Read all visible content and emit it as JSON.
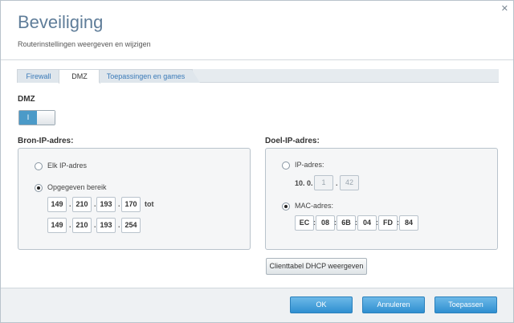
{
  "header": {
    "title": "Beveiliging",
    "subtitle": "Routerinstellingen weergeven en wijzigen",
    "close": "✕"
  },
  "tabs": [
    {
      "label": "Firewall",
      "active": false
    },
    {
      "label": "DMZ",
      "active": true
    },
    {
      "label": "Toepassingen en games",
      "active": false
    }
  ],
  "dmz": {
    "label": "DMZ",
    "toggle_on_label": "I",
    "enabled": true
  },
  "source": {
    "heading": "Bron-IP-adres:",
    "option_any": "Elk IP-adres",
    "option_range": "Opgegeven bereik",
    "selected": "range",
    "to_label": "tot",
    "range_start": [
      "149",
      "210",
      "193",
      "170"
    ],
    "range_end": [
      "149",
      "210",
      "193",
      "254"
    ]
  },
  "destination": {
    "heading": "Doel-IP-adres:",
    "option_ip": "IP-adres:",
    "ip_prefix": "10. 0.",
    "ip_octets": [
      "1",
      "42"
    ],
    "option_mac": "MAC-adres:",
    "selected": "mac",
    "mac_parts": [
      "EC",
      "08",
      "6B",
      "04",
      "FD",
      "84"
    ],
    "dhcp_button": "Clienttabel DHCP weergeven"
  },
  "footer": {
    "ok": "OK",
    "cancel": "Annuleren",
    "apply": "Toepassen"
  },
  "colors": {
    "accent": "#2f8fd0",
    "title": "#5f7d99"
  }
}
